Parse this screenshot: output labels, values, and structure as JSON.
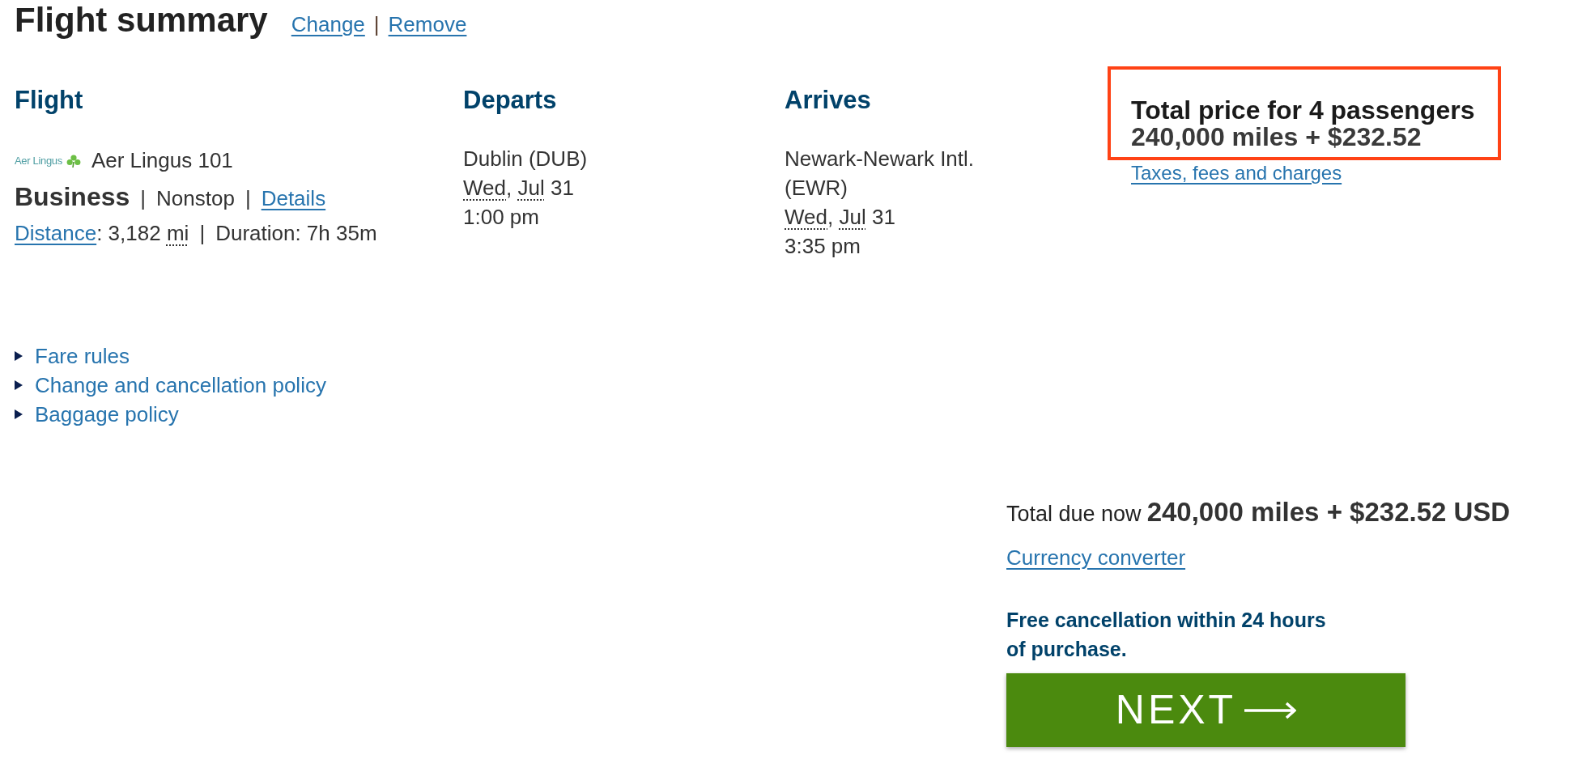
{
  "header": {
    "title": "Flight summary",
    "change_link": "Change",
    "separator": "|",
    "remove_link": "Remove"
  },
  "flight": {
    "heading": "Flight",
    "logo_text": "Aer Lingus",
    "number": "Aer Lingus 101",
    "cabin": "Business",
    "separator_1": "|",
    "stops": "Nonstop",
    "separator_2": "|",
    "details_link": "Details",
    "distance_link": "Distance",
    "distance_value": ": 3,182",
    "distance_unit": "mi",
    "separator_3": "|",
    "duration": "Duration: 7h 35m"
  },
  "departs": {
    "heading": "Departs",
    "airport": "Dublin (DUB)",
    "date": [
      {
        "text": "Wed",
        "abbreviation": true
      },
      {
        "text": ", ",
        "abbreviation": false
      },
      {
        "text": "Jul",
        "abbreviation": true
      },
      {
        "text": " 31",
        "abbreviation": false
      }
    ],
    "time": "1:00 pm"
  },
  "arrives": {
    "heading": "Arrives",
    "airport": "Newark-Newark Intl. (EWR)",
    "date": [
      {
        "text": "Wed",
        "abbreviation": true
      },
      {
        "text": ", ",
        "abbreviation": false
      },
      {
        "text": "Jul",
        "abbreviation": true
      },
      {
        "text": " 31",
        "abbreviation": false
      }
    ],
    "time": "3:35 pm"
  },
  "price": {
    "title": "Total price for 4 passengers",
    "amount": "240,000 miles + $232.52",
    "taxes_link": "Taxes, fees and charges"
  },
  "policies": [
    {
      "text": "Fare rules",
      "expanded": false
    },
    {
      "text": "Change and cancellation policy",
      "expanded": false
    },
    {
      "text": "Baggage policy",
      "expanded": false
    }
  ],
  "total_due": {
    "label": "Total due now",
    "amount": "240,000 miles + $232.52 USD"
  },
  "currency_link": "Currency converter",
  "cancellation_note": "Free cancellation within 24 hours of purchase.",
  "next_button": {
    "label": "NEXT"
  }
}
